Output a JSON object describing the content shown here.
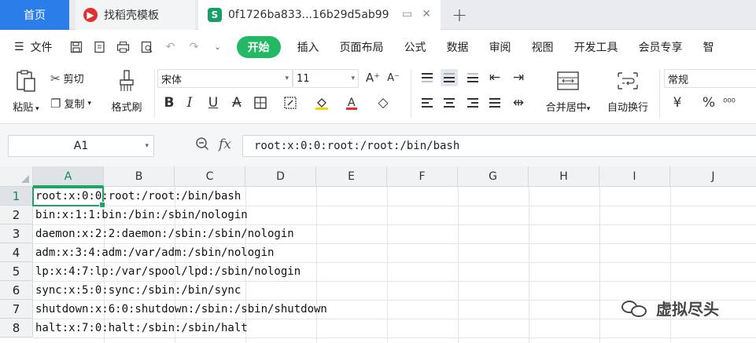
{
  "tabs": [
    {
      "label": "首页"
    },
    {
      "label": "找稻壳模板"
    },
    {
      "label": "0f1726ba833...16b29d5ab99"
    }
  ],
  "menu": {
    "file": "文件",
    "items": [
      "开始",
      "插入",
      "页面布局",
      "公式",
      "数据",
      "审阅",
      "视图",
      "开发工具",
      "会员专享",
      "智"
    ]
  },
  "ribbon": {
    "paste": "粘贴",
    "cut": "剪切",
    "copy": "复制",
    "format_painter": "格式刷",
    "font_name": "宋体",
    "font_size": "11",
    "merge_center": "合并居中",
    "wrap_text": "自动换行",
    "number_format": "常规"
  },
  "formula_bar": {
    "cell_ref": "A1",
    "fx": "fx",
    "content": "root:x:0:0:root:/root:/bin/bash"
  },
  "grid": {
    "columns": [
      "A",
      "B",
      "C",
      "D",
      "E",
      "F",
      "G",
      "H",
      "I",
      "J"
    ],
    "selected_column": "A",
    "rows": [
      {
        "num": "1",
        "text": "root:x:0:0:root:/root:/bin/bash"
      },
      {
        "num": "2",
        "text": "bin:x:1:1:bin:/bin:/sbin/nologin"
      },
      {
        "num": "3",
        "text": "daemon:x:2:2:daemon:/sbin:/sbin/nologin"
      },
      {
        "num": "4",
        "text": "adm:x:3:4:adm:/var/adm:/sbin/nologin"
      },
      {
        "num": "5",
        "text": "lp:x:4:7:lp:/var/spool/lpd:/sbin/nologin"
      },
      {
        "num": "6",
        "text": "sync:x:5:0:sync:/sbin:/bin/sync"
      },
      {
        "num": "7",
        "text": "shutdown:x:6:0:shutdown:/sbin:/sbin/shutdown"
      },
      {
        "num": "8",
        "text": "halt:x:7:0:halt:/sbin:/sbin/halt"
      }
    ]
  },
  "watermark": "虚拟尽头",
  "colors": {
    "accent_green": "#1fa467",
    "home_tab_blue": "#2b7de9",
    "start_button_green": "#23b864"
  }
}
